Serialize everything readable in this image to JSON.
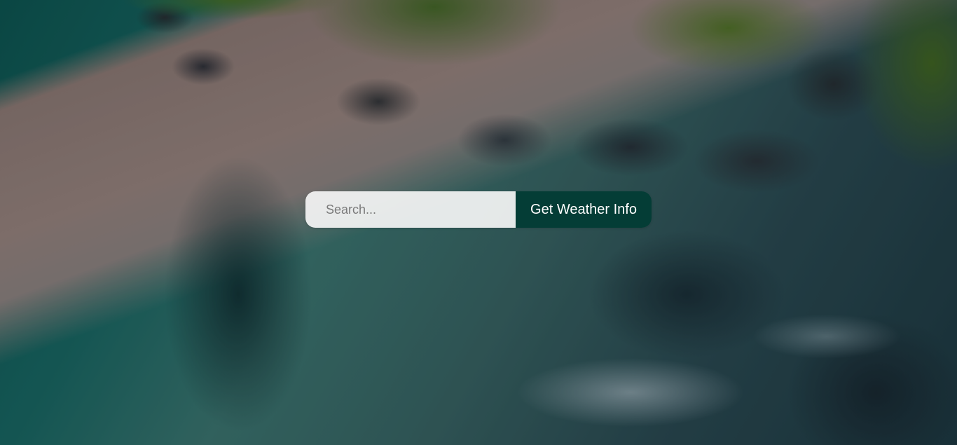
{
  "search": {
    "placeholder": "Search...",
    "value": "",
    "button_label": "Get Weather Info"
  },
  "background": {
    "description_icon": "aerial-beach-background"
  },
  "colors": {
    "button_bg": "#043d36",
    "button_text": "#ffffff",
    "input_bg": "#f5f5f5"
  }
}
